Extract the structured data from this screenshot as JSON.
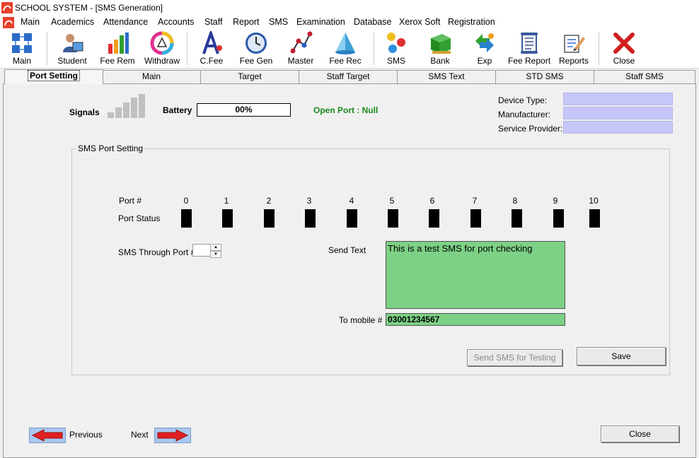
{
  "window": {
    "title": "SCHOOL SYSTEM - [SMS Generation]"
  },
  "menu": [
    "Main",
    "Academics",
    "Attendance",
    "Accounts",
    "Staff",
    "Report",
    "SMS",
    "Examination",
    "Database",
    "Xerox Soft",
    "Registration"
  ],
  "toolbar": [
    {
      "label": "Main",
      "icon": "grid-icon"
    },
    {
      "label": "Student",
      "icon": "student-icon"
    },
    {
      "label": "Fee Rem",
      "icon": "bar-chart-icon"
    },
    {
      "label": "Withdraw",
      "icon": "color-wheel-icon"
    },
    {
      "label": "C.Fee",
      "icon": "font-icon"
    },
    {
      "label": "Fee Gen",
      "icon": "clock-icon"
    },
    {
      "label": "Master",
      "icon": "graph-icon"
    },
    {
      "label": "Fee Rec",
      "icon": "pyramid-icon"
    },
    {
      "label": "SMS",
      "icon": "bubbles-icon"
    },
    {
      "label": "Bank",
      "icon": "bank-icon"
    },
    {
      "label": "Exp",
      "icon": "arrows-icon"
    },
    {
      "label": "Fee Report",
      "icon": "scroll-icon"
    },
    {
      "label": "Reports",
      "icon": "report-icon"
    },
    {
      "label": "Close",
      "icon": "close-icon"
    }
  ],
  "tabs": [
    "Port Setting",
    "Main",
    "Target",
    "Staff Target",
    "SMS Text",
    "STD SMS",
    "Staff SMS"
  ],
  "status": {
    "signals_label": "Signals",
    "battery_label": "Battery",
    "battery_value": "00%",
    "open_port": "Open Port : Null"
  },
  "device": {
    "type_label": "Device Type:",
    "manufacturer_label": "Manufacturer:",
    "provider_label": "Service Provider:"
  },
  "port_setting": {
    "group_title": "SMS Port Setting",
    "port_label": "Port #",
    "status_label": "Port Status",
    "ports": [
      "0",
      "1",
      "2",
      "3",
      "4",
      "5",
      "6",
      "7",
      "8",
      "9",
      "10"
    ],
    "through_label": "SMS Through Port #",
    "send_text_label": "Send Text",
    "send_text": "This is a test SMS for port checking",
    "mobile_label": "To mobile #",
    "mobile": "03001234567",
    "test_button": "Send SMS for Testing",
    "save_button": "Save"
  },
  "nav": {
    "previous": "Previous",
    "next": "Next",
    "close": "Close"
  },
  "colors": {
    "field_green": "#7dd186",
    "info_box": "#c6c6f8",
    "open_port": "#1a8a1a",
    "arrow_red": "#e02020"
  }
}
